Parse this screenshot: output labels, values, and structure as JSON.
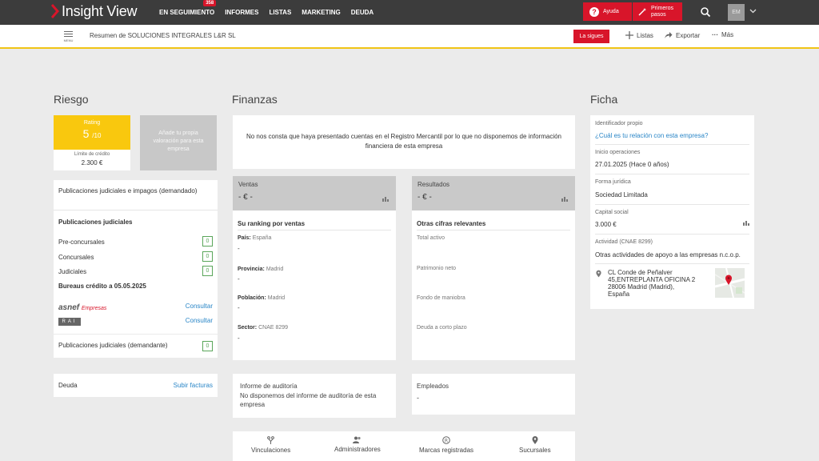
{
  "topbar": {
    "logo": "Insight View",
    "nav": [
      {
        "label": "EN SEGUIMIENTO",
        "badge": "358"
      },
      {
        "label": "INFORMES"
      },
      {
        "label": "LISTAS"
      },
      {
        "label": "MARKETING"
      },
      {
        "label": "DEUDA"
      }
    ],
    "help_label": "Ayuda",
    "first_steps_label": "Primeros pasos",
    "avatar_initials": "EM"
  },
  "subbar": {
    "menu_label": "MENU",
    "summary": "Resumen de SOLUCIONES INTEGRALES L&R SL",
    "follow_label": "La sigues",
    "lists_label": "Listas",
    "export_label": "Exportar",
    "more_label": "Más"
  },
  "riesgo": {
    "title": "Riesgo",
    "rating_label": "Rating",
    "rating_value": "5",
    "rating_max": "/10",
    "limit_label": "Límite de crédito",
    "limit_value": "2.300 €",
    "add_valuation": "Añade tu propia valoración para esta empresa",
    "pub_title": "Publicaciones judiciales e impagos (demandado)",
    "pub_sub": "Publicaciones judiciales",
    "rows": [
      {
        "label": "Pre-concursales",
        "count": "0"
      },
      {
        "label": "Concursales",
        "count": "0"
      },
      {
        "label": "Judiciales",
        "count": "0"
      }
    ],
    "bureaus_title": "Bureaus crédito a 05.05.2025",
    "asnef_main": "asnef",
    "asnef_sub": "Empresas",
    "rai_label": "RAI",
    "consult_label": "Consultar",
    "demandante_label": "Publicaciones judiciales (demandante)",
    "demandante_count": "0",
    "deuda_label": "Deuda",
    "deuda_link": "Subir facturas"
  },
  "finanzas": {
    "title": "Finanzas",
    "notice": "No nos consta que haya presentado cuentas en el Registro Mercantil por lo que no disponemos de información financiera de esta empresa",
    "ventas": {
      "head": "Ventas",
      "value": "- € -",
      "sub": "Su ranking por ventas",
      "items": [
        {
          "key": "País:",
          "val": "España",
          "dash": "-"
        },
        {
          "key": "Provincia:",
          "val": "Madrid",
          "dash": "-"
        },
        {
          "key": "Población:",
          "val": "Madrid",
          "dash": "-"
        },
        {
          "key": "Sector:",
          "val": "CNAE 8299",
          "dash": "-"
        }
      ]
    },
    "resultados": {
      "head": "Resultados",
      "value": "- € -",
      "sub": "Otras cifras relevantes",
      "items": [
        "Total activo",
        "Patrimonio neto",
        "Fondo de maniobra",
        "Deuda a corto plazo"
      ]
    },
    "audit_title": "Informe de auditoría",
    "audit_text": "No disponemos del informe de auditoría de esta empresa",
    "empleados_title": "Empleados",
    "empleados_value": "-",
    "tabs": [
      "Vinculaciones",
      "Administradores",
      "Marcas registradas",
      "Sucursales"
    ]
  },
  "ficha": {
    "title": "Ficha",
    "id_label": "Identificador propio",
    "id_link": "¿Cuál es tu relación con esta empresa?",
    "inicio_label": "Inicio operaciones",
    "inicio_value": "27.01.2025 (Hace 0 años)",
    "forma_label": "Forma jurídica",
    "forma_value": "Sociedad Limitada",
    "capital_label": "Capital social",
    "capital_value": "3.000 €",
    "actividad_label": "Actividad (CNAE 8299)",
    "actividad_value": "Otras actividades de apoyo a las empresas n.c.o.p.",
    "address_lines": [
      "CL Conde de Peñalver",
      "45,ENTREPLANTA OFICINA 2",
      "28006 Madrid (Madrid),",
      "España"
    ]
  },
  "colors": {
    "brand_red": "#d8152a",
    "rating_yellow": "#f9c80e",
    "link_blue": "#2a86c7",
    "count_green": "#5aa65a"
  }
}
